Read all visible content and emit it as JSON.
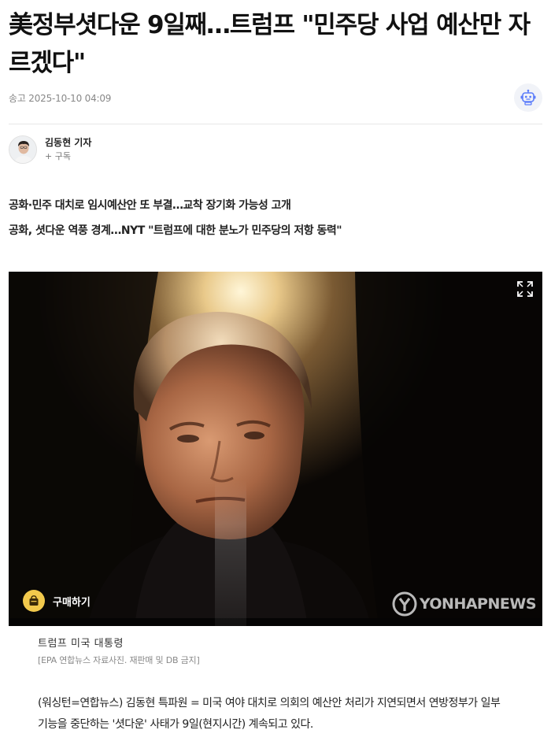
{
  "article": {
    "headline": "美정부셧다운 9일째…트럼프 \"민주당 사업 예산만 자르겠다\"",
    "timestamp": "송고 2025-10-10 04:09"
  },
  "reporter": {
    "name": "김동현 기자",
    "subscribe_label": "+ 구독"
  },
  "summary": [
    "공화·민주 대치로 임시예산안 또 부결…교착 장기화 가능성 고개",
    "공화, 셧다운 역풍 경계…NYT \"트럼프에 대한 분노가 민주당의 저항 동력\""
  ],
  "photo": {
    "buy_label": "구매하기",
    "watermark": "YONHAPNEWS",
    "caption": "트럼프 미국 대통령",
    "credit": "[EPA 연합뉴스 자료사진. 재판매 및 DB 금지]"
  },
  "body": {
    "text": "(워싱턴=연합뉴스) 김동현 특파원 = 미국 여야 대치로 의회의 예산안 처리가 지연되면서 연방정부가 일부 기능을 중단하는 '셧다운' 사태가 9일(현지시간) 계속되고 있다."
  },
  "icons": {
    "robot": "robot-icon",
    "expand": "expand-icon",
    "buy": "shopping-bag-icon"
  },
  "colors": {
    "buy_button": "#f2c94c",
    "robot_accent": "#5b7cfa"
  }
}
